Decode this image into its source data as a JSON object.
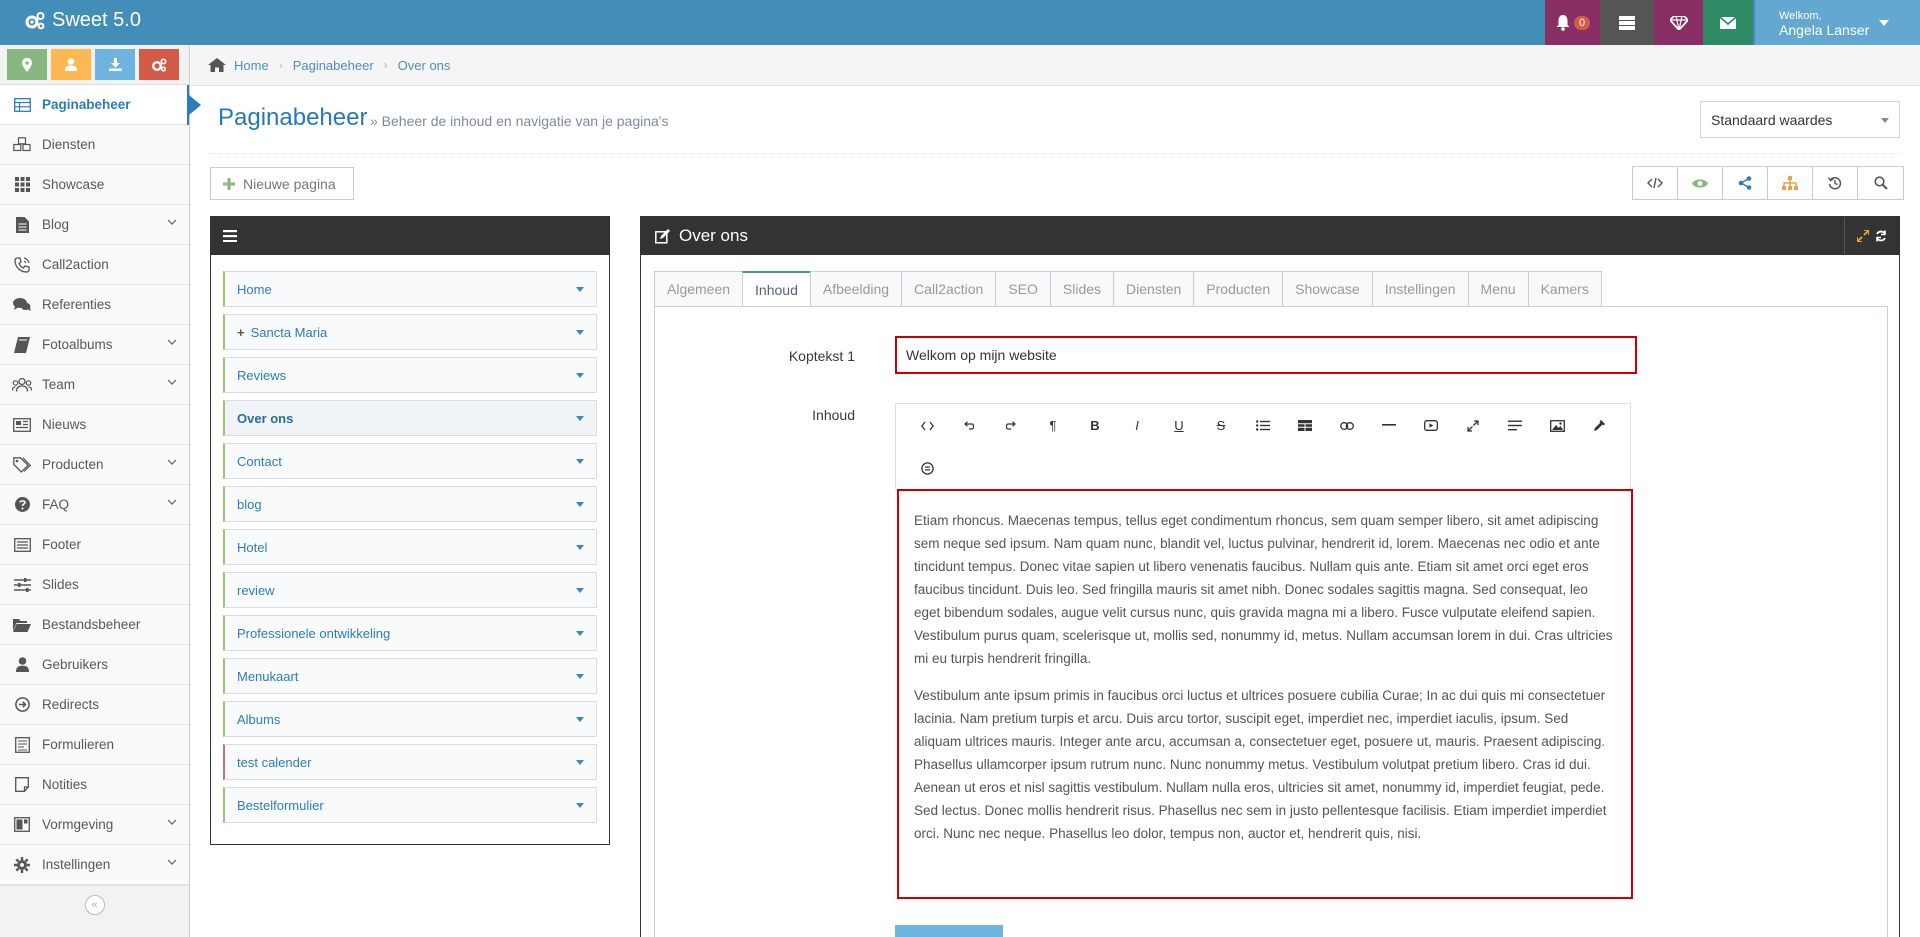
{
  "app": {
    "title": "Sweet 5.0"
  },
  "topbar": {
    "notification_count": "0",
    "welcome_label": "Welkom,",
    "user_name": "Angela Lanser"
  },
  "sidebar": {
    "items": [
      {
        "label": "Paginabeheer",
        "icon": "table-icon",
        "active": true
      },
      {
        "label": "Diensten",
        "icon": "cubes-icon"
      },
      {
        "label": "Showcase",
        "icon": "grid-icon"
      },
      {
        "label": "Blog",
        "icon": "file-icon",
        "submenu": true
      },
      {
        "label": "Call2action",
        "icon": "phone-icon"
      },
      {
        "label": "Referenties",
        "icon": "comments-icon"
      },
      {
        "label": "Fotoalbums",
        "icon": "book-icon",
        "submenu": true
      },
      {
        "label": "Team",
        "icon": "users-icon",
        "submenu": true
      },
      {
        "label": "Nieuws",
        "icon": "newspaper-icon"
      },
      {
        "label": "Producten",
        "icon": "tags-icon",
        "submenu": true
      },
      {
        "label": "FAQ",
        "icon": "question-icon",
        "submenu": true
      },
      {
        "label": "Footer",
        "icon": "list-alt-icon"
      },
      {
        "label": "Slides",
        "icon": "sliders-icon"
      },
      {
        "label": "Bestandsbeheer",
        "icon": "folder-open-icon"
      },
      {
        "label": "Gebruikers",
        "icon": "user-icon"
      },
      {
        "label": "Redirects",
        "icon": "arrow-circle-icon"
      },
      {
        "label": "Formulieren",
        "icon": "form-icon"
      },
      {
        "label": "Notities",
        "icon": "note-icon"
      },
      {
        "label": "Vormgeving",
        "icon": "layout-icon",
        "submenu": true
      },
      {
        "label": "Instellingen",
        "icon": "cog-icon",
        "submenu": true
      }
    ]
  },
  "breadcrumb": [
    "Home",
    "Paginabeheer",
    "Over ons"
  ],
  "page": {
    "title": "Paginabeheer",
    "subtitle": "» Beheer de inhoud en navigatie van je pagina's",
    "select_value": "Standaard waardes",
    "new_page_label": "Nieuwe pagina"
  },
  "tree": [
    {
      "label": "Home"
    },
    {
      "label": "Sancta Maria",
      "plus": true
    },
    {
      "label": "Reviews"
    },
    {
      "label": "Over ons",
      "active": true
    },
    {
      "label": "Contact"
    },
    {
      "label": "blog"
    },
    {
      "label": "Hotel"
    },
    {
      "label": "review"
    },
    {
      "label": "Professionele ontwikkeling"
    },
    {
      "label": "Menukaart"
    },
    {
      "label": "Albums"
    },
    {
      "label": "test calender",
      "red": true
    },
    {
      "label": "Bestelformulier"
    }
  ],
  "editor": {
    "header_title": "Over ons",
    "tabs": [
      "Algemeen",
      "Inhoud",
      "Afbeelding",
      "Call2action",
      "SEO",
      "Slides",
      "Diensten",
      "Producten",
      "Showcase",
      "Instellingen",
      "Menu",
      "Kamers"
    ],
    "active_tab": "Inhoud",
    "koptekst_label": "Koptekst 1",
    "koptekst_value": "Welkom op mijn website",
    "inhoud_label": "Inhoud",
    "paragraphs": [
      "Etiam rhoncus. Maecenas tempus, tellus eget condimentum rhoncus, sem quam semper libero, sit amet adipiscing sem neque sed ipsum. Nam quam nunc, blandit vel, luctus pulvinar, hendrerit id, lorem. Maecenas nec odio et ante tincidunt tempus. Donec vitae sapien ut libero venenatis faucibus. Nullam quis ante. Etiam sit amet orci eget eros faucibus tincidunt. Duis leo. Sed fringilla mauris sit amet nibh. Donec sodales sagittis magna. Sed consequat, leo eget bibendum sodales, augue velit cursus nunc, quis gravida magna mi a libero. Fusce vulputate eleifend sapien. Vestibulum purus quam, scelerisque ut, mollis sed, nonummy id, metus. Nullam accumsan lorem in dui. Cras ultricies mi eu turpis hendrerit fringilla.",
      "Vestibulum ante ipsum primis in faucibus orci luctus et ultrices posuere cubilia Curae; In ac dui quis mi consectetuer lacinia. Nam pretium turpis et arcu. Duis arcu tortor, suscipit eget, imperdiet nec, imperdiet iaculis, ipsum. Sed aliquam ultrices mauris. Integer ante arcu, accumsan a, consectetuer eget, posuere ut, mauris. Praesent adipiscing. Phasellus ullamcorper ipsum rutrum nunc. Nunc nonummy metus. Vestibulum volutpat pretium libero. Cras id dui. Aenean ut eros et nisl sagittis vestibulum. Nullam nulla eros, ultricies sit amet, nonummy id, imperdiet feugiat, pede. Sed lectus. Donec mollis hendrerit risus. Phasellus nec sem in justo pellentesque facilisis. Etiam imperdiet imperdiet orci. Nunc nec neque. Phasellus leo dolor, tempus non, auctor et, hendrerit quis, nisi."
    ]
  },
  "colors": {
    "topbar": "#438eb9",
    "accent": "#2b7dbc",
    "highlight_border": "#cc0000",
    "widget_header": "#333333"
  }
}
